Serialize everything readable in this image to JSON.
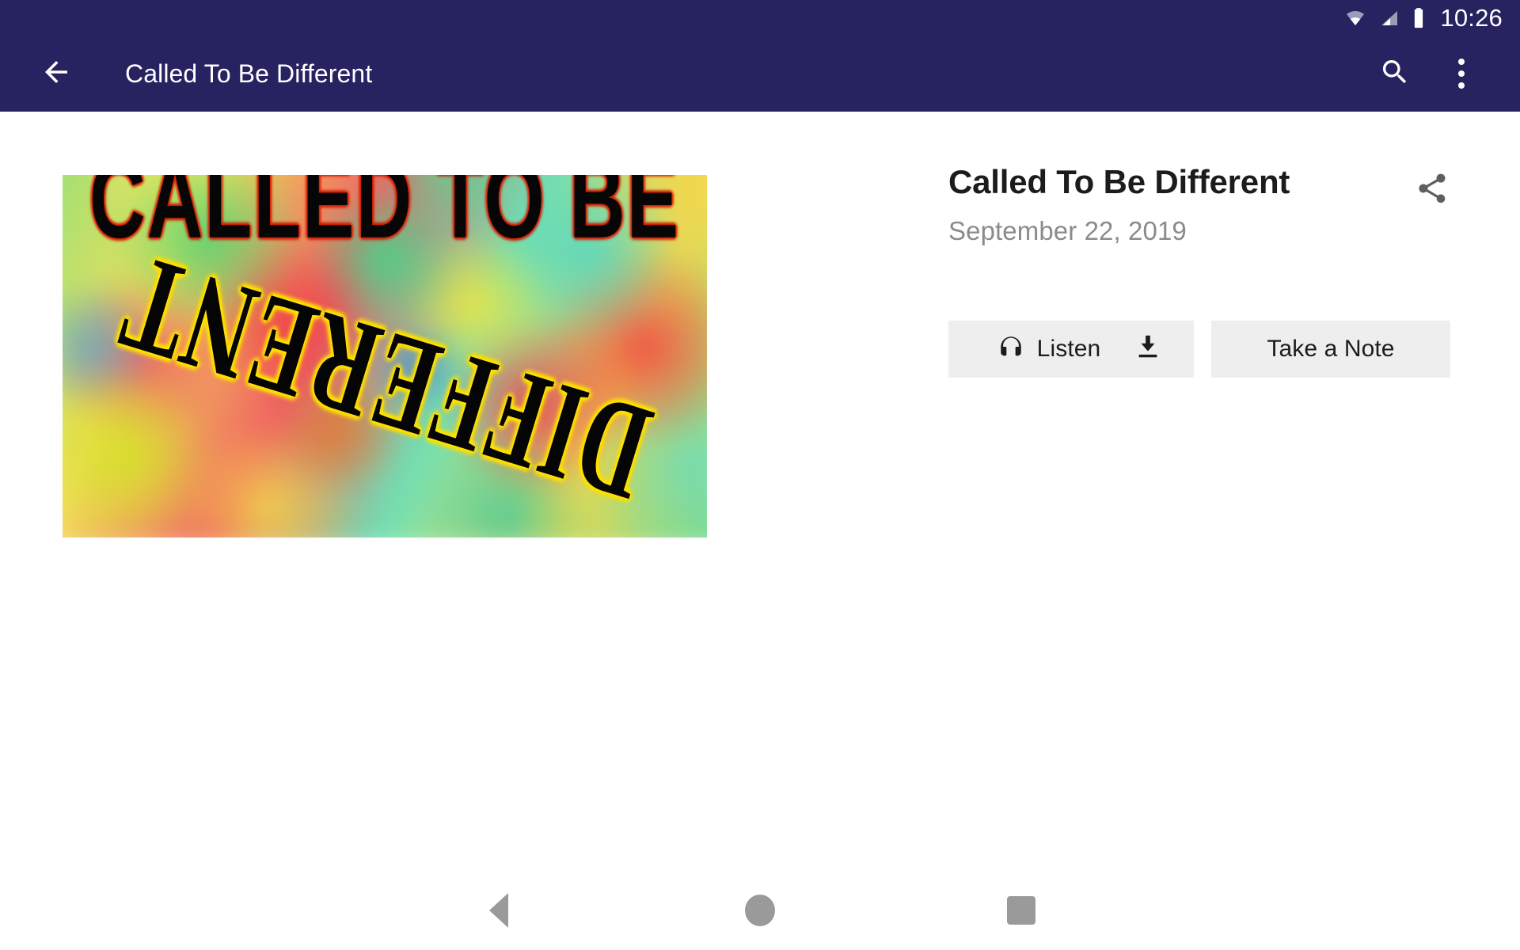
{
  "status_bar": {
    "clock": "10:26",
    "icons": [
      "wifi-icon",
      "cell-signal-icon",
      "battery-icon"
    ],
    "background_color": "#272260"
  },
  "app_bar": {
    "back_icon": "arrow-back-icon",
    "title": "Called To Be Different",
    "search_icon": "search-icon",
    "overflow_icon": "more-vert-icon",
    "background_color": "#272260",
    "text_color": "#ffffff"
  },
  "hero": {
    "image_alt": "Called To Be Different sermon artwork",
    "text_top": "CALLED TO BE",
    "text_bottom": "DIFFERENT"
  },
  "detail": {
    "title": "Called To Be Different",
    "date": "September 22, 2019",
    "share_icon": "share-icon",
    "title_color": "#1c1c1c",
    "date_color": "#8b8b8b"
  },
  "actions": {
    "listen_label": "Listen",
    "listen_icon": "headphones-icon",
    "download_icon": "download-icon",
    "note_label": "Take a Note",
    "button_background": "#eeeeee"
  },
  "nav_bar": {
    "back_icon": "nav-back-triangle-icon",
    "home_icon": "nav-home-circle-icon",
    "recents_icon": "nav-recents-square-icon",
    "icon_color": "#9a9a9a"
  }
}
